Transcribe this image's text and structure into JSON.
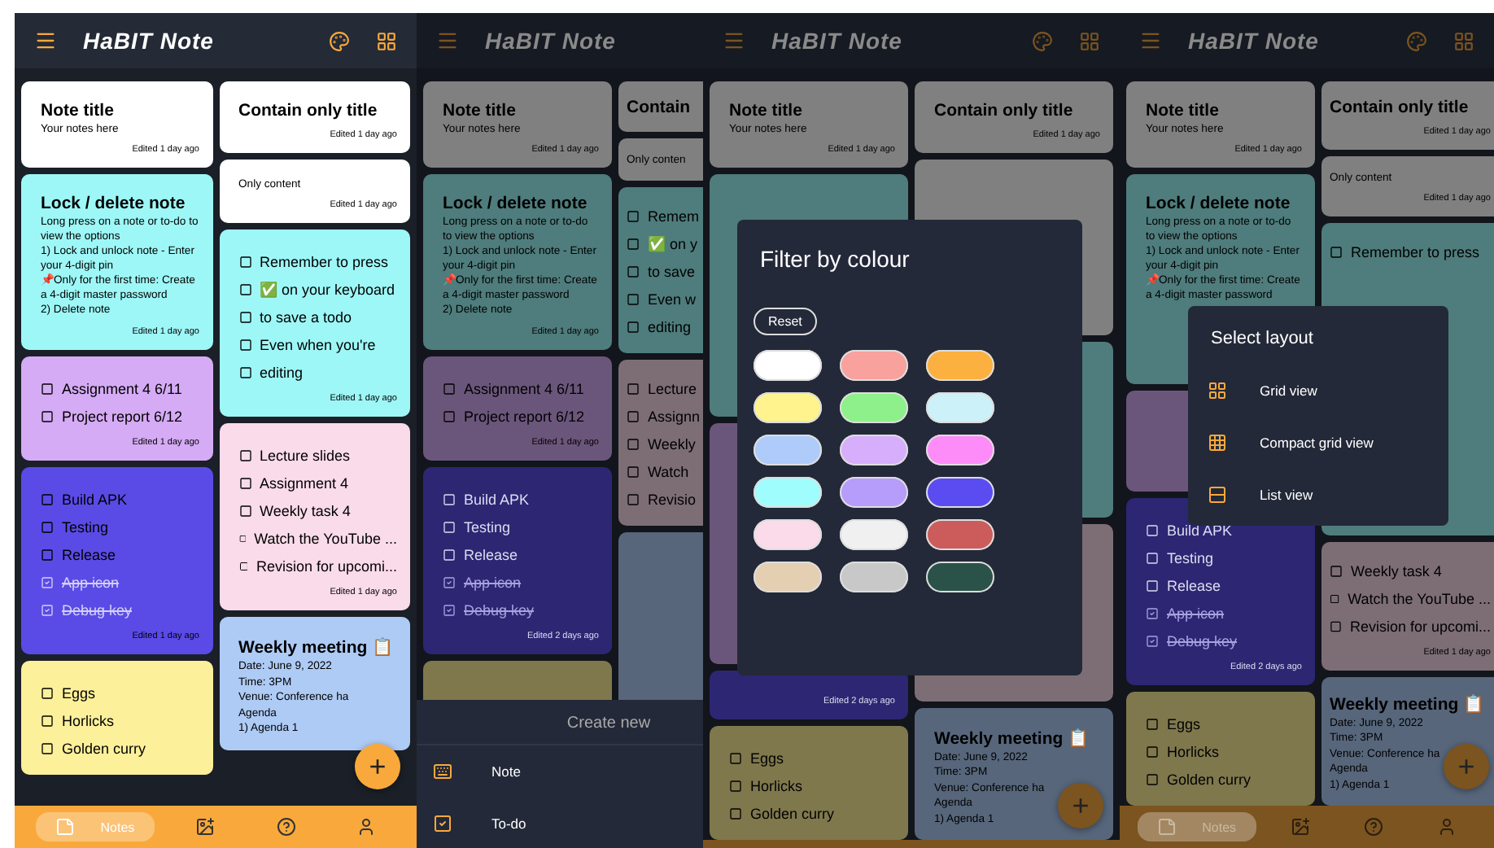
{
  "screens": [
    {
      "dimmed": false,
      "cut_right": false,
      "header": {
        "title": "HaBIT Note",
        "show_actions": true
      },
      "columns": [
        [
          {
            "kind": "text",
            "color": "#ffffff",
            "title": "Note title",
            "body": [
              "Your notes here"
            ],
            "edited": "Edited 1 day ago"
          },
          {
            "kind": "text",
            "color": "#9ef7f7",
            "title": "Lock / delete note",
            "body": [
              "Long press on a note or to-do to view the options",
              "1) Lock and unlock note - Enter your 4-digit pin",
              "📌Only for the first time: Create a 4-digit master password",
              "2) Delete note"
            ],
            "edited": "Edited 1 day ago"
          },
          {
            "kind": "todo",
            "color": "#d5abf5",
            "items": [
              {
                "text": "Assignment 4 6/11",
                "checked": false
              },
              {
                "text": "Project report 6/12",
                "checked": false
              }
            ],
            "edited": "Edited 1 day ago"
          },
          {
            "kind": "todo",
            "color": "#5a4be6",
            "items": [
              {
                "text": "Build APK",
                "checked": false
              },
              {
                "text": "Testing",
                "checked": false
              },
              {
                "text": "Release",
                "checked": false
              },
              {
                "text": "App icon",
                "checked": true
              },
              {
                "text": "Debug key",
                "checked": true
              }
            ],
            "edited": "Edited 1 day ago"
          },
          {
            "kind": "todo",
            "color": "#fdf09a",
            "items": [
              {
                "text": "Eggs",
                "checked": false
              },
              {
                "text": "Horlicks",
                "checked": false
              },
              {
                "text": "Golden curry",
                "checked": false
              }
            ]
          }
        ],
        [
          {
            "kind": "text",
            "color": "#ffffff",
            "title": "Contain only title",
            "edited": "Edited 1 day ago"
          },
          {
            "kind": "text",
            "color": "#ffffff",
            "body": [
              "Only content"
            ],
            "edited": "Edited 1 day ago"
          },
          {
            "kind": "todo",
            "color": "#9ef7f7",
            "items": [
              {
                "text": "Remember to press",
                "checked": false
              },
              {
                "text": "✅ on your keyboard",
                "checked": false
              },
              {
                "text": "to save a todo",
                "checked": false
              },
              {
                "text": "Even when you're",
                "checked": false
              },
              {
                "text": "editing",
                "checked": false
              }
            ],
            "edited": "Edited 1 day ago"
          },
          {
            "kind": "todo",
            "color": "#fadbe9",
            "items": [
              {
                "text": "Lecture slides",
                "checked": false
              },
              {
                "text": "Assignment 4",
                "checked": false
              },
              {
                "text": "Weekly task 4",
                "checked": false
              },
              {
                "text": "Watch the YouTube ...",
                "checked": false
              },
              {
                "text": "Revision for upcomi...",
                "checked": false
              }
            ],
            "edited": "Edited 1 day ago"
          },
          {
            "kind": "text",
            "color": "#aecbf5",
            "title": "Weekly meeting 📋",
            "body": [
              "Date: June 9, 2022",
              "Time: 3PM",
              "Venue: Conference ha",
              "Agenda",
              "1) Agenda 1"
            ]
          }
        ]
      ],
      "fab": "+",
      "nav": [
        {
          "kind": "notes",
          "label": "Notes",
          "selected": true
        },
        {
          "kind": "image-search",
          "selected": false
        },
        {
          "kind": "help",
          "selected": false
        },
        {
          "kind": "person",
          "selected": false
        }
      ]
    },
    {
      "dimmed": true,
      "cut_right": true,
      "header": {
        "title": "HaBIT Note",
        "show_actions": false
      },
      "columns": [
        [
          {
            "kind": "text",
            "color": "#808080",
            "title": "Note title",
            "body": [
              "Your notes here"
            ],
            "edited": "Edited 1 day ago"
          },
          {
            "kind": "text",
            "color": "#4f7c7c",
            "title": "Lock / delete note",
            "body": [
              "Long press on a note or to-do to view the options",
              "1) Lock and unlock note - Enter your 4-digit pin",
              "📌Only for the first time: Create a 4-digit master password",
              "2) Delete note"
            ],
            "edited": "Edited 1 day ago"
          },
          {
            "kind": "todo",
            "color": "#6b567b",
            "items": [
              {
                "text": "Assignment 4 6/11",
                "checked": false
              },
              {
                "text": "Project report 6/12",
                "checked": false
              }
            ],
            "edited": "Edited 1 day ago"
          },
          {
            "kind": "todo",
            "color": "#2d2673",
            "items": [
              {
                "text": "Build APK",
                "checked": false
              },
              {
                "text": "Testing",
                "checked": false
              },
              {
                "text": "Release",
                "checked": false
              },
              {
                "text": "App icon",
                "checked": true
              },
              {
                "text": "Debug key",
                "checked": true
              }
            ],
            "edited": "Edited 2 days ago"
          },
          {
            "kind": "covered",
            "color": "#7f784d"
          }
        ],
        [
          {
            "kind": "text",
            "color": "#808080",
            "title": "Contain"
          },
          {
            "kind": "text",
            "color": "#808080",
            "body": [
              "Only conten"
            ]
          },
          {
            "kind": "todo",
            "color": "#4f7c7c",
            "items": [
              {
                "text": "Remem",
                "checked": false
              },
              {
                "text": "✅ on y",
                "checked": false
              },
              {
                "text": "to save",
                "checked": false
              },
              {
                "text": "Even w",
                "checked": false
              },
              {
                "text": "editing",
                "checked": false
              }
            ]
          },
          {
            "kind": "todo",
            "color": "#7d6e75",
            "items": [
              {
                "text": "Lecture",
                "checked": false
              },
              {
                "text": "Assignn",
                "checked": false
              },
              {
                "text": "Weekly",
                "checked": false
              },
              {
                "text": "Watch",
                "checked": false
              },
              {
                "text": "Revisio",
                "checked": false
              }
            ]
          },
          {
            "kind": "covered",
            "color": "#57667b"
          }
        ]
      ],
      "overlay": {
        "kind": "create_sheet",
        "title": "Create new",
        "items": [
          {
            "kind": "note",
            "label": "Note"
          },
          {
            "kind": "todo",
            "label": "To-do"
          }
        ]
      }
    },
    {
      "dimmed": true,
      "cut_right": false,
      "header": {
        "title": "HaBIT Note",
        "show_actions": true
      },
      "columns": [
        [
          {
            "kind": "text",
            "color": "#808080",
            "title": "Note title",
            "body": [
              "Your notes here"
            ],
            "edited": "Edited 1 day ago"
          },
          {
            "kind": "covered",
            "color": "#4f7c7c"
          },
          {
            "kind": "covered",
            "color": "#6b567b"
          },
          {
            "kind": "text",
            "color": "#2d2673",
            "edited": "Edited 2 days ago"
          },
          {
            "kind": "todo",
            "color": "#7f784d",
            "items": [
              {
                "text": "Eggs",
                "checked": false
              },
              {
                "text": "Horlicks",
                "checked": false
              },
              {
                "text": "Golden curry",
                "checked": false
              }
            ]
          }
        ],
        [
          {
            "kind": "text",
            "color": "#808080",
            "title": "Contain only title",
            "edited": "Edited 1 day ago"
          },
          {
            "kind": "covered",
            "color": "#808080"
          },
          {
            "kind": "covered",
            "color": "#4f7c7c"
          },
          {
            "kind": "covered",
            "color": "#7d6e75"
          },
          {
            "kind": "text",
            "color": "#57667b",
            "title": "Weekly meeting 📋",
            "body": [
              "Date: June 9, 2022",
              "Time: 3PM",
              "Venue: Conference ha",
              "Agenda",
              "1) Agenda 1"
            ]
          }
        ]
      ],
      "fab": "+",
      "overlay": {
        "kind": "color_filter",
        "title": "Filter by colour",
        "reset": "Reset",
        "colors": [
          {
            "color": "#ffffff"
          },
          {
            "color": "#f8a19d"
          },
          {
            "color": "#fbb040"
          },
          {
            "color": "#fff38d"
          },
          {
            "color": "#8ef08a"
          },
          {
            "color": "#cdf1f9"
          },
          {
            "color": "#aecbfa"
          },
          {
            "color": "#d7aefb"
          },
          {
            "color": "#fd8cf8"
          },
          {
            "color": "#a0fdfd"
          },
          {
            "color": "#b69cfb"
          },
          {
            "color": "#5a4cf1"
          },
          {
            "color": "#fbdbe9"
          },
          {
            "color": "#f0f0f0"
          },
          {
            "color": "#cc5c5c"
          },
          {
            "color": "#e5cfb3"
          },
          {
            "color": "#c8c8c8"
          },
          {
            "color": "#2a5248"
          }
        ]
      }
    },
    {
      "dimmed": true,
      "cut_right": true,
      "header": {
        "title": "HaBIT Note",
        "show_actions": true
      },
      "columns": [
        [
          {
            "kind": "text",
            "color": "#808080",
            "title": "Note title",
            "body": [
              "Your notes here"
            ],
            "edited": "Edited 1 day ago"
          },
          {
            "kind": "text",
            "color": "#4f7c7c",
            "partly_covered": true,
            "title": "Lock / delete note",
            "body": [
              "Long press on a note or to-do to view the options",
              "1) Lock and unlock note - Enter your 4-digit pin",
              "📌Only for the first time: Create a 4-digit master password"
            ]
          },
          {
            "kind": "covered",
            "color": "#6b567b"
          },
          {
            "kind": "todo",
            "color": "#2d2673",
            "items": [
              {
                "text": "Build APK",
                "checked": false
              },
              {
                "text": "Testing",
                "checked": false
              },
              {
                "text": "Release",
                "checked": false
              },
              {
                "text": "App icon",
                "checked": true
              },
              {
                "text": "Debug key",
                "checked": true
              }
            ],
            "edited": "Edited 2 days ago"
          },
          {
            "kind": "todo",
            "color": "#7f784d",
            "items": [
              {
                "text": "Eggs",
                "checked": false
              },
              {
                "text": "Horlicks",
                "checked": false
              },
              {
                "text": "Golden curry",
                "checked": false
              }
            ]
          }
        ],
        [
          {
            "kind": "text",
            "color": "#808080",
            "title": "Contain only title",
            "edited": "Edited 1 day ago"
          },
          {
            "kind": "text",
            "color": "#808080",
            "body": [
              "Only content"
            ],
            "edited": "Edited 1 day ago"
          },
          {
            "kind": "todo",
            "color": "#4f7c7c",
            "partly_covered": true,
            "items": [
              {
                "text": "Remember to press",
                "checked": false
              }
            ]
          },
          {
            "kind": "todo",
            "color": "#7d6e75",
            "items": [
              {
                "text": "Weekly task 4",
                "checked": false
              },
              {
                "text": "Watch the YouTube ...",
                "checked": false
              },
              {
                "text": "Revision for upcomi...",
                "checked": false
              }
            ],
            "edited": "Edited 1 day ago"
          },
          {
            "kind": "text",
            "color": "#57667b",
            "title": "Weekly meeting 📋",
            "body": [
              "Date: June 9, 2022",
              "Time: 3PM",
              "Venue: Conference ha",
              "Agenda",
              "1) Agenda 1"
            ]
          }
        ]
      ],
      "fab": "+",
      "nav": [
        {
          "kind": "notes",
          "label": "Notes",
          "selected": true
        },
        {
          "kind": "image-search",
          "selected": false
        },
        {
          "kind": "help",
          "selected": false
        },
        {
          "kind": "person",
          "selected": false
        }
      ],
      "overlay": {
        "kind": "layout_menu",
        "title": "Select layout",
        "items": [
          {
            "kind": "grid",
            "label": "Grid view"
          },
          {
            "kind": "compact",
            "label": "Compact grid view"
          },
          {
            "kind": "list",
            "label": "List view"
          }
        ]
      }
    }
  ]
}
